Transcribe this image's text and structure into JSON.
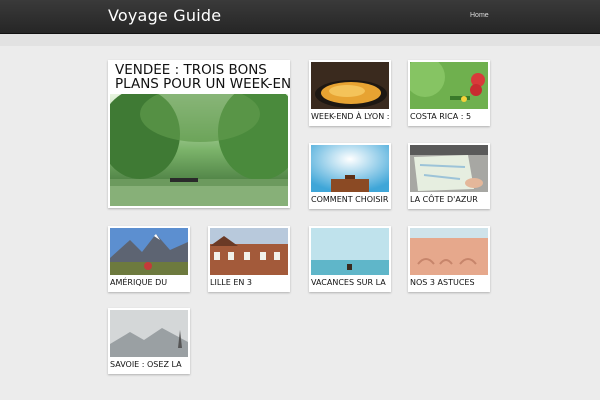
{
  "header": {
    "site_title": "Voyage Guide",
    "nav_home": "Home"
  },
  "featured": {
    "title_line1": "VENDÉE : TROIS BONS",
    "title_line2": "PLANS POUR UN WEEK-END"
  },
  "cards": [
    {
      "caption": "WEEK-END À LYON :"
    },
    {
      "caption": "COSTA RICA : 5"
    },
    {
      "caption": "COMMENT CHOISIR"
    },
    {
      "caption": "LA CÔTE D'AZUR"
    },
    {
      "caption": "AMÉRIQUE DU"
    },
    {
      "caption": "LILLE EN 3"
    },
    {
      "caption": "VACANCES SUR LA"
    },
    {
      "caption": "NOS 3 ASTUCES"
    },
    {
      "caption": "SAVOIE : OSEZ LA"
    }
  ],
  "icons": {
    "photo": "photo-thumbnail-icon"
  },
  "colors": {
    "topbar": "#2e2e2e",
    "background": "#ececec",
    "card": "#ffffff"
  }
}
